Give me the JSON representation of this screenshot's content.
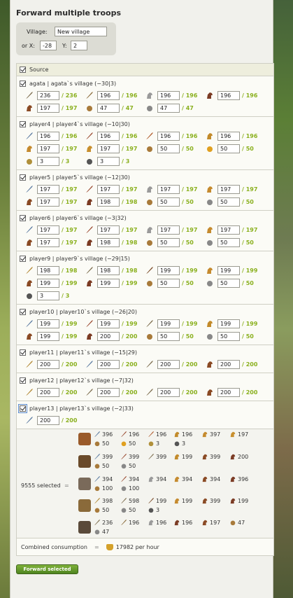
{
  "title": "Forward multiple troops",
  "village_form": {
    "village_label": "Village:",
    "village_value": "New village",
    "or_x_label": "or X:",
    "x_value": "-28",
    "y_label": "Y:",
    "y_value": "2"
  },
  "source_label": "Source",
  "players": [
    {
      "name": "agata | agata`s village (−30|3)",
      "rows": [
        [
          {
            "icon": "axe-icon",
            "value": "236",
            "max": "236"
          },
          {
            "icon": "crossbow-icon",
            "value": "196",
            "max": "196"
          },
          {
            "icon": "horse-icon",
            "value": "196",
            "max": "196"
          },
          {
            "icon": "cavalry-icon",
            "value": "196",
            "max": "196"
          }
        ],
        [
          {
            "icon": "horse-brown-icon",
            "value": "197",
            "max": "197"
          },
          {
            "icon": "ram-icon",
            "value": "47",
            "max": "47"
          },
          {
            "icon": "catapult-icon",
            "value": "47",
            "max": "47"
          }
        ]
      ]
    },
    {
      "name": "player4 | player4`s village (−10|30)",
      "rows": [
        [
          {
            "icon": "spear-icon",
            "value": "196",
            "max": "196"
          },
          {
            "icon": "sword-icon",
            "value": "196",
            "max": "196"
          },
          {
            "icon": "lance-icon",
            "value": "196",
            "max": "196"
          },
          {
            "icon": "scout-icon",
            "value": "196",
            "max": "196"
          }
        ],
        [
          {
            "icon": "knight-icon",
            "value": "197",
            "max": "197"
          },
          {
            "icon": "paladin-icon",
            "value": "197",
            "max": "197"
          },
          {
            "icon": "ram-icon",
            "value": "50",
            "max": "50"
          },
          {
            "icon": "fist-icon",
            "value": "50",
            "max": "50"
          }
        ],
        [
          {
            "icon": "chief-icon",
            "value": "3",
            "max": "3"
          },
          {
            "icon": "settler-icon",
            "value": "3",
            "max": "3"
          }
        ]
      ]
    },
    {
      "name": "player5 | player5`s village (−12|30)",
      "rows": [
        [
          {
            "icon": "spear-icon",
            "value": "197",
            "max": "197"
          },
          {
            "icon": "sword-icon",
            "value": "197",
            "max": "197"
          },
          {
            "icon": "horse-icon",
            "value": "197",
            "max": "197"
          },
          {
            "icon": "knight-icon",
            "value": "197",
            "max": "197"
          }
        ],
        [
          {
            "icon": "horse-brown-icon",
            "value": "197",
            "max": "197"
          },
          {
            "icon": "cavalry-icon",
            "value": "198",
            "max": "198"
          },
          {
            "icon": "ram-icon",
            "value": "50",
            "max": "50"
          },
          {
            "icon": "catapult-icon",
            "value": "50",
            "max": "50"
          }
        ]
      ]
    },
    {
      "name": "player6 | player6`s village (−3|32)",
      "rows": [
        [
          {
            "icon": "spear-icon",
            "value": "197",
            "max": "197"
          },
          {
            "icon": "sword-icon",
            "value": "197",
            "max": "197"
          },
          {
            "icon": "horse-icon",
            "value": "197",
            "max": "197"
          },
          {
            "icon": "knight-icon",
            "value": "197",
            "max": "197"
          }
        ],
        [
          {
            "icon": "horse-brown-icon",
            "value": "197",
            "max": "197"
          },
          {
            "icon": "cavalry-icon",
            "value": "198",
            "max": "198"
          },
          {
            "icon": "ram-icon",
            "value": "50",
            "max": "50"
          },
          {
            "icon": "catapult-icon",
            "value": "50",
            "max": "50"
          }
        ]
      ]
    },
    {
      "name": "player9 | player9`s village (−29|15)",
      "rows": [
        [
          {
            "icon": "club-icon",
            "value": "198",
            "max": "198"
          },
          {
            "icon": "axe-icon",
            "value": "198",
            "max": "198"
          },
          {
            "icon": "bow-icon",
            "value": "199",
            "max": "199"
          },
          {
            "icon": "knight-icon",
            "value": "199",
            "max": "199"
          }
        ],
        [
          {
            "icon": "horse-brown-icon",
            "value": "199",
            "max": "199"
          },
          {
            "icon": "cavalry-icon",
            "value": "199",
            "max": "199"
          },
          {
            "icon": "ram-icon",
            "value": "50",
            "max": "50"
          },
          {
            "icon": "catapult-icon",
            "value": "50",
            "max": "50"
          }
        ],
        [
          {
            "icon": "settler-icon",
            "value": "3",
            "max": "3"
          }
        ]
      ]
    },
    {
      "name": "player10 | player10`s village (−26|20)",
      "rows": [
        [
          {
            "icon": "spear-icon",
            "value": "199",
            "max": "199"
          },
          {
            "icon": "sword-icon",
            "value": "199",
            "max": "199"
          },
          {
            "icon": "axe-icon",
            "value": "199",
            "max": "199"
          },
          {
            "icon": "scout-icon",
            "value": "199",
            "max": "199"
          }
        ],
        [
          {
            "icon": "horse-brown-icon",
            "value": "199",
            "max": "199"
          },
          {
            "icon": "cavalry-icon",
            "value": "200",
            "max": "200"
          },
          {
            "icon": "ram-icon",
            "value": "50",
            "max": "50"
          },
          {
            "icon": "catapult-icon",
            "value": "50",
            "max": "50"
          }
        ]
      ]
    },
    {
      "name": "player11 | player11`s village (−15|29)",
      "rows": [
        [
          {
            "icon": "club-icon",
            "value": "200",
            "max": "200"
          },
          {
            "icon": "spear-icon",
            "value": "200",
            "max": "200"
          },
          {
            "icon": "axe-icon",
            "value": "200",
            "max": "200"
          },
          {
            "icon": "horse-brown-icon",
            "value": "200",
            "max": "200"
          }
        ]
      ]
    },
    {
      "name": "player12 | player12`s village (−7|32)",
      "rows": [
        [
          {
            "icon": "club-icon",
            "value": "200",
            "max": "200"
          },
          {
            "icon": "axe-icon",
            "value": "200",
            "max": "200"
          },
          {
            "icon": "axe-icon",
            "value": "200",
            "max": "200"
          },
          {
            "icon": "horse-brown-icon",
            "value": "200",
            "max": "200"
          }
        ]
      ]
    },
    {
      "name": "player13 | player13`s village (−2|33)",
      "rows": [
        [
          {
            "icon": "spear-icon",
            "value": "200",
            "max": "200"
          }
        ]
      ]
    }
  ],
  "selected_label": "9555 selected",
  "summary": [
    {
      "items": [
        {
          "icon": "spear-icon",
          "value": "396"
        },
        {
          "icon": "sword-icon",
          "value": "196"
        },
        {
          "icon": "lance-icon",
          "value": "196"
        },
        {
          "icon": "scout-icon",
          "value": "196"
        },
        {
          "icon": "knight-icon",
          "value": "397"
        },
        {
          "icon": "paladin-icon",
          "value": "197"
        },
        {
          "icon": "ram-icon",
          "value": "50"
        },
        {
          "icon": "fist-icon",
          "value": "50"
        },
        {
          "icon": "chief-icon",
          "value": "3"
        },
        {
          "icon": "settler-icon",
          "value": "3"
        }
      ]
    },
    {
      "items": [
        {
          "icon": "spear-icon",
          "value": "399"
        },
        {
          "icon": "sword-icon",
          "value": "399"
        },
        {
          "icon": "axe-icon",
          "value": "399"
        },
        {
          "icon": "scout-icon",
          "value": "199"
        },
        {
          "icon": "horse-brown-icon",
          "value": "399"
        },
        {
          "icon": "cavalry-icon",
          "value": "200"
        },
        {
          "icon": "ram-icon",
          "value": "50"
        },
        {
          "icon": "catapult-icon",
          "value": "50"
        }
      ]
    },
    {
      "items": [
        {
          "icon": "spear-icon",
          "value": "394"
        },
        {
          "icon": "sword-icon",
          "value": "394"
        },
        {
          "icon": "horse-icon",
          "value": "394"
        },
        {
          "icon": "knight-icon",
          "value": "394"
        },
        {
          "icon": "horse-brown-icon",
          "value": "394"
        },
        {
          "icon": "cavalry-icon",
          "value": "396"
        },
        {
          "icon": "ram-icon",
          "value": "100"
        },
        {
          "icon": "catapult-icon",
          "value": "100"
        }
      ]
    },
    {
      "items": [
        {
          "icon": "club-icon",
          "value": "398"
        },
        {
          "icon": "axe-icon",
          "value": "598"
        },
        {
          "icon": "bow-icon",
          "value": "199"
        },
        {
          "icon": "knight-icon",
          "value": "199"
        },
        {
          "icon": "horse-brown-icon",
          "value": "399"
        },
        {
          "icon": "cavalry-icon",
          "value": "199"
        },
        {
          "icon": "ram-icon",
          "value": "50"
        },
        {
          "icon": "catapult-icon",
          "value": "50"
        },
        {
          "icon": "settler-icon",
          "value": "3"
        }
      ]
    },
    {
      "items": [
        {
          "icon": "axe-icon",
          "value": "236"
        },
        {
          "icon": "crossbow-icon",
          "value": "196"
        },
        {
          "icon": "horse-icon",
          "value": "196"
        },
        {
          "icon": "cavalry-icon",
          "value": "196"
        },
        {
          "icon": "horse-brown-icon",
          "value": "197"
        },
        {
          "icon": "ram-icon",
          "value": "47"
        },
        {
          "icon": "catapult-icon",
          "value": "47"
        }
      ]
    }
  ],
  "combined_label": "Combined consumption",
  "combined_value": "17982 per hour",
  "forward_button": "Forward selected",
  "colors": {
    "max_green": "#8ab01e",
    "button_green": "#5f9527",
    "panel_bg": "#f1f1ec"
  }
}
